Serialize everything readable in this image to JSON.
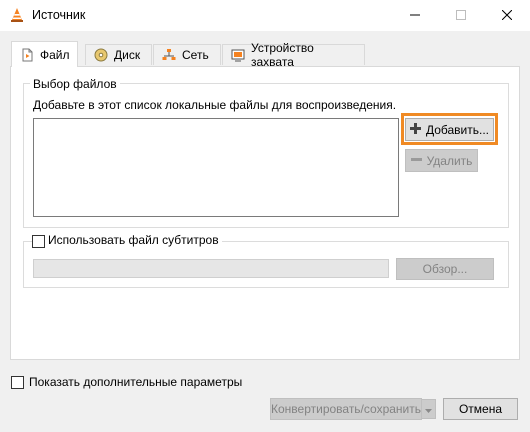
{
  "window": {
    "title": "Источник",
    "icon": "vlc-cone-icon"
  },
  "tabs": [
    {
      "label": "Файл",
      "icon": "file-icon",
      "active": true
    },
    {
      "label": "Диск",
      "icon": "disc-icon",
      "active": false
    },
    {
      "label": "Сеть",
      "icon": "network-icon",
      "active": false
    },
    {
      "label": "Устройство захвата",
      "icon": "capture-device-icon",
      "active": false
    }
  ],
  "file_selection": {
    "group_title": "Выбор файлов",
    "hint": "Добавьте в этот список локальные файлы для воспроизведения.",
    "add_button": "Добавить...",
    "remove_button": "Удалить",
    "files": []
  },
  "subtitles": {
    "checkbox_label": "Использовать файл субтитров",
    "checked": false,
    "path_value": "",
    "browse_button": "Обзор..."
  },
  "footer": {
    "show_more_label": "Показать дополнительные параметры",
    "show_more_checked": false,
    "convert_button": "Конвертировать/сохранить",
    "cancel_button": "Отмена"
  },
  "colors": {
    "highlight": "#f08a24",
    "vlc_orange": "#f58220"
  }
}
